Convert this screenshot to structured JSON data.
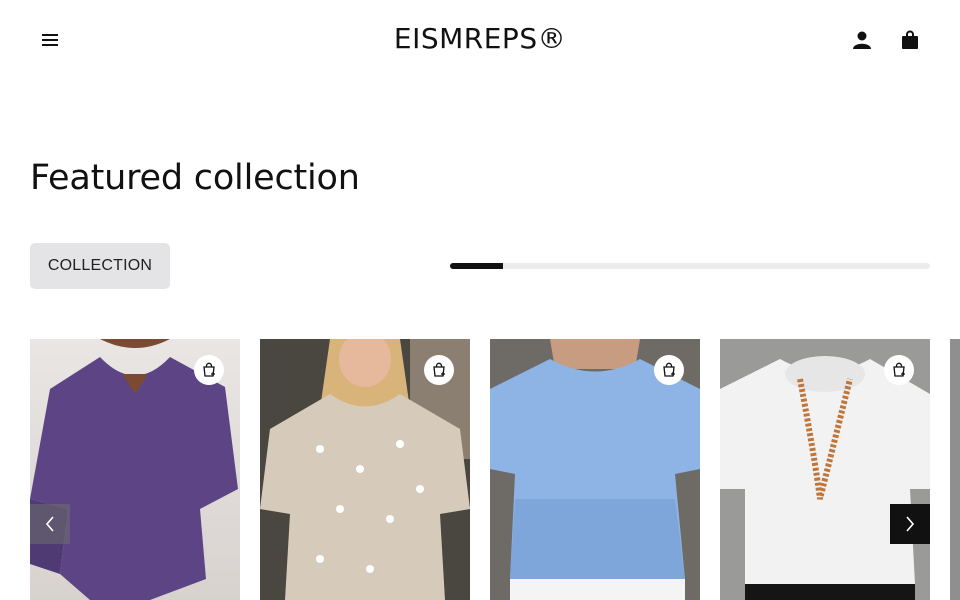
{
  "header": {
    "brand": "EISMREPS®",
    "menu_icon": "hamburger-menu-icon",
    "account_icon": "user-icon",
    "cart_icon": "shopping-bag-icon"
  },
  "section": {
    "title": "Featured collection",
    "collection_button": "COLLECTION",
    "slider_progress": 0.11
  },
  "products": [
    {
      "image": "purple v-neck asymmetric hem tunic top",
      "quick_add_icon": "quick-add-cart-icon",
      "color": "#5d4585"
    },
    {
      "image": "beige daisy print round neck top",
      "quick_add_icon": "quick-add-cart-icon",
      "color": "#d6cbbb"
    },
    {
      "image": "light blue short sleeve peplum top",
      "quick_add_icon": "quick-add-cart-icon",
      "color": "#8eb4e6"
    },
    {
      "image": "white cowl neck top with beaded necklace",
      "quick_add_icon": "quick-add-cart-icon",
      "color": "#f2f2f2"
    }
  ],
  "carousel": {
    "prev_icon": "chevron-left-icon",
    "next_icon": "chevron-right-icon"
  },
  "colors": {
    "text": "#111111",
    "button_bg": "#e4e4e6",
    "track": "#ececec",
    "fill": "#111111"
  }
}
